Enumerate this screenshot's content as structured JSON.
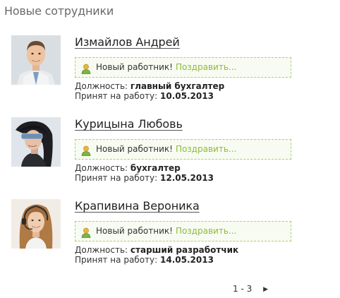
{
  "widget": {
    "title": "Новые сотрудники"
  },
  "employees": [
    {
      "name": "Измайлов Андрей",
      "newbie_text": "Новый работник!",
      "congrats_link": "Поздравить...",
      "position_label": "Должность:",
      "position": "главный бухгалтер",
      "hired_label": "Принят на работу:",
      "hired_date": "10.05.2013",
      "avatar_icon": "man-photo"
    },
    {
      "name": "Курицына Любовь",
      "newbie_text": "Новый работник!",
      "congrats_link": "Поздравить...",
      "position_label": "Должность:",
      "position": "бухгалтер",
      "hired_label": "Принят на работу:",
      "hired_date": "12.05.2013",
      "avatar_icon": "woman-sunglasses-photo"
    },
    {
      "name": "Крапивина Вероника",
      "newbie_text": "Новый работник!",
      "congrats_link": "Поздравить...",
      "position_label": "Должность:",
      "position": "старший разработчик",
      "hired_label": "Принят на работу:",
      "hired_date": "14.05.2013",
      "avatar_icon": "woman-headset-photo"
    }
  ],
  "pager": {
    "range": "1 - 3",
    "next_icon": "triangle-right-icon"
  },
  "colors": {
    "accent_green": "#8dbb3b",
    "box_border": "#a7d16b",
    "box_background": "#f8fbf2"
  }
}
